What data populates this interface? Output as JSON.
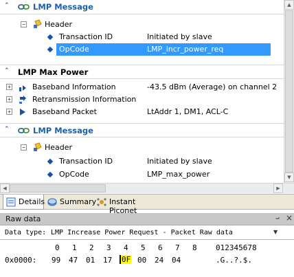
{
  "details_tree": {
    "msg1": {
      "title": "LMP Message",
      "header": "Header",
      "rows": [
        {
          "label": "Transaction ID",
          "value": "Initiated by slave"
        },
        {
          "label": "OpCode",
          "value": "LMP_incr_power_req"
        }
      ]
    },
    "power": {
      "title": "LMP Max Power",
      "rows": [
        {
          "label": "Baseband Information",
          "value": "-43.5 dBm (Average) on channel 2"
        },
        {
          "label": "Retransmission Information",
          "value": ""
        },
        {
          "label": "Baseband Packet",
          "value": "LtAddr 1, DM1, ACL-C"
        }
      ]
    },
    "msg2": {
      "title": "LMP Message",
      "header": "Header",
      "rows": [
        {
          "label": "Transaction ID",
          "value": "Initiated by slave"
        },
        {
          "label": "OpCode",
          "value": "LMP_max_power"
        }
      ]
    }
  },
  "tabs": [
    {
      "label": "Details"
    },
    {
      "label": "Summary"
    },
    {
      "label": "Instant Piconet"
    }
  ],
  "raw_panel": {
    "title": "Raw data",
    "pin_glyph": "⨼",
    "close_glyph": "×",
    "data_type_label": "Data type:",
    "data_type_value": "LMP Increase Power Request - Packet Raw data",
    "col_headers": [
      "0",
      "1",
      "2",
      "3",
      "4",
      "5",
      "6",
      "7",
      "8"
    ],
    "ascii_header": "012345678",
    "offset": "0x0000:",
    "bytes": [
      "99",
      "47",
      "01",
      "17",
      "0F",
      "00",
      "24",
      "04"
    ],
    "ascii": ".G..?.$.",
    "highlight_color": "#ffff00"
  },
  "colors": {
    "section_title": "#1f5fa8",
    "selection": "#3399ff"
  }
}
